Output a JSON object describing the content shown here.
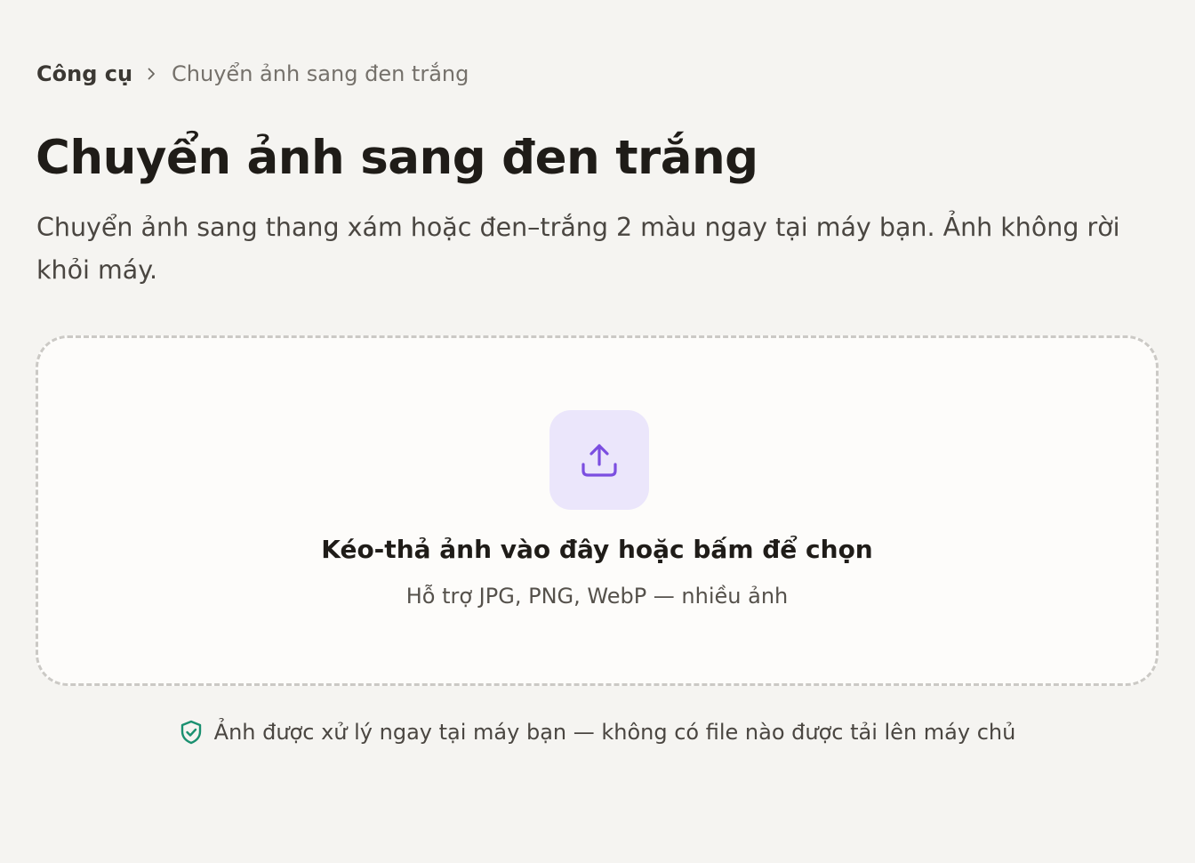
{
  "breadcrumb": {
    "parent": "Công cụ",
    "separator_icon": "chevron-right-icon",
    "current": "Chuyển ảnh sang đen trắng"
  },
  "header": {
    "title": "Chuyển ảnh sang đen trắng",
    "description": "Chuyển ảnh sang thang xám hoặc đen–trắng 2 màu ngay tại máy bạn. Ảnh không rời khỏi máy."
  },
  "dropzone": {
    "icon": "upload-icon",
    "title": "Kéo-thả ảnh vào đây hoặc bấm để chọn",
    "hint": "Hỗ trợ JPG, PNG, WebP — nhiều ảnh"
  },
  "privacy": {
    "icon": "shield-check-icon",
    "text": "Ảnh được xử lý ngay tại máy bạn — không có file nào được tải lên máy chủ"
  },
  "colors": {
    "background": "#f5f4f1",
    "accent": "#7b4ee0",
    "accent_bg": "#ebe6fb",
    "success": "#1a9070"
  }
}
